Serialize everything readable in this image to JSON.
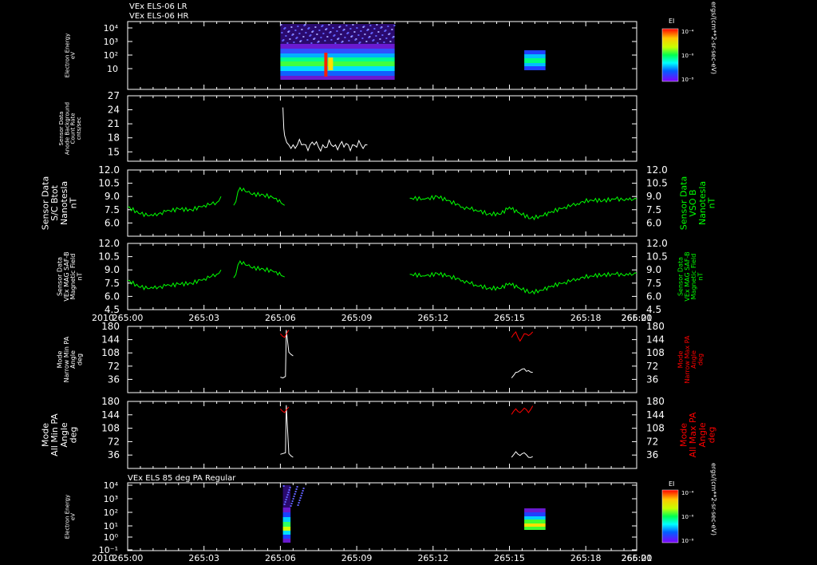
{
  "header": {
    "line1": "VEx ELS-06 LR",
    "line2": "VEx ELS-06 HR",
    "lower_spec_title": "VEx ELS 85 deg PA Regular"
  },
  "time_axis": {
    "year": "2010",
    "ticks": [
      "265:00",
      "265:03",
      "265:06",
      "265:09",
      "265:12",
      "265:15",
      "265:18",
      "265:21",
      "266:00"
    ]
  },
  "colors": {
    "background": "#000000",
    "foreground": "#ffffff",
    "green": "#00ff00",
    "red": "#ff0000"
  },
  "colorbar": {
    "title": "EI",
    "ticks": [
      "10⁻⁴",
      "10⁻⁶",
      "10⁻⁸"
    ],
    "units": "ergs/(cm**2-sr-sec-eV)"
  },
  "chart_data": [
    {
      "type": "heatmap",
      "panel": "spectrogram-lr-hr",
      "ylabel_lines": [
        "Electron Energy",
        "eV"
      ],
      "y_ticks": [
        "10⁴",
        "10³",
        "10²",
        "10"
      ],
      "colorbar": "EI",
      "data_blocks_minutes": [
        [
          0,
          0
        ]
      ]
    },
    {
      "type": "line",
      "panel": "background",
      "ylabel_lines": [
        "Sensor Data",
        "Anode Background",
        "Count Rate",
        "cnts/sec"
      ],
      "y_ticks": [
        "27",
        "24",
        "21",
        "18",
        "15"
      ],
      "ylim": [
        13,
        27
      ],
      "series": [
        {
          "color": "#ffffff",
          "segments": [
            [
              [
                366,
                24.5
              ],
              [
                368,
                20
              ],
              [
                370,
                18.5
              ],
              [
                375,
                17
              ],
              [
                380,
                16.5
              ],
              [
                390,
                16.5
              ],
              [
                400,
                16.5
              ],
              [
                410,
                16.5
              ],
              [
                420,
                16.5
              ],
              [
                430,
                16.5
              ],
              [
                440,
                16.5
              ],
              [
                450,
                16
              ],
              [
                460,
                16.5
              ],
              [
                470,
                16
              ],
              [
                480,
                16.5
              ],
              [
                490,
                16.5
              ],
              [
                500,
                16.5
              ],
              [
                510,
                16
              ],
              [
                520,
                16.5
              ],
              [
                530,
                16.5
              ],
              [
                540,
                16
              ],
              [
                550,
                16.5
              ],
              [
                560,
                16.5
              ],
              [
                565,
                16.5
              ]
            ]
          ]
        }
      ]
    },
    {
      "type": "line",
      "panel": "bfield-total",
      "ylabel_lines": [
        "Sensor Data",
        "S/C Btot",
        "Nanotesla",
        "nT"
      ],
      "ylabel_right_lines": [
        "Sensor Data",
        "VSO B",
        "Nanotesla",
        "nT"
      ],
      "y_ticks": [
        "12.0",
        "10.5",
        "9.0",
        "7.5",
        "6.0"
      ],
      "ylim": [
        4.5,
        12.0
      ],
      "series": [
        {
          "color": "#00ff00",
          "segments": [
            [
              [
                0,
                7.8
              ],
              [
                30,
                7.0
              ],
              [
                60,
                6.8
              ],
              [
                90,
                7.3
              ],
              [
                120,
                7.6
              ],
              [
                150,
                7.5
              ],
              [
                180,
                8.0
              ],
              [
                210,
                8.3
              ],
              [
                220,
                9.0
              ]
            ],
            [
              [
                250,
                8.0
              ],
              [
                265,
                10.0
              ],
              [
                290,
                9.3
              ],
              [
                320,
                9.2
              ],
              [
                350,
                8.8
              ],
              [
                370,
                8.0
              ]
            ],
            [
              [
                665,
                8.8
              ],
              [
                700,
                8.7
              ],
              [
                730,
                9.0
              ],
              [
                760,
                8.5
              ],
              [
                790,
                7.8
              ],
              [
                820,
                7.5
              ],
              [
                850,
                7.0
              ],
              [
                880,
                7.0
              ],
              [
                900,
                7.8
              ],
              [
                920,
                7.2
              ],
              [
                950,
                6.5
              ],
              [
                980,
                6.8
              ],
              [
                1000,
                7.3
              ],
              [
                1030,
                7.8
              ],
              [
                1060,
                8.2
              ],
              [
                1090,
                8.6
              ],
              [
                1120,
                8.5
              ],
              [
                1150,
                8.7
              ],
              [
                1180,
                8.6
              ],
              [
                1200,
                8.7
              ]
            ]
          ]
        }
      ]
    },
    {
      "type": "line",
      "panel": "bfield-mag",
      "ylabel_lines": [
        "Sensor Data",
        "VEx MAG SAF-B",
        "Magnetic Field",
        "nT"
      ],
      "ylabel_right_lines": [
        "Sensor Data",
        "VEx MAG SAF-B",
        "Magnetic Field",
        "nT"
      ],
      "y_ticks": [
        "12.0",
        "10.5",
        "9.0",
        "7.5",
        "6.0",
        "4.5"
      ],
      "ylim": [
        4.5,
        12.0
      ],
      "series": [
        {
          "color": "#00ff00",
          "segments": [
            [
              [
                0,
                7.8
              ],
              [
                30,
                7.0
              ],
              [
                60,
                6.9
              ],
              [
                90,
                7.2
              ],
              [
                120,
                7.4
              ],
              [
                150,
                7.5
              ],
              [
                180,
                8.0
              ],
              [
                210,
                8.5
              ],
              [
                220,
                9.0
              ]
            ],
            [
              [
                250,
                8.1
              ],
              [
                265,
                10.0
              ],
              [
                290,
                9.3
              ],
              [
                320,
                9.1
              ],
              [
                350,
                8.8
              ],
              [
                370,
                8.2
              ]
            ],
            [
              [
                665,
                8.5
              ],
              [
                700,
                8.3
              ],
              [
                730,
                8.6
              ],
              [
                760,
                8.3
              ],
              [
                790,
                7.8
              ],
              [
                820,
                7.3
              ],
              [
                850,
                6.9
              ],
              [
                880,
                6.9
              ],
              [
                900,
                7.5
              ],
              [
                920,
                7.0
              ],
              [
                950,
                6.4
              ],
              [
                980,
                6.7
              ],
              [
                1000,
                7.2
              ],
              [
                1030,
                7.6
              ],
              [
                1060,
                8.0
              ],
              [
                1090,
                8.3
              ],
              [
                1120,
                8.4
              ],
              [
                1150,
                8.5
              ],
              [
                1180,
                8.4
              ],
              [
                1200,
                8.6
              ]
            ]
          ]
        }
      ]
    },
    {
      "type": "line",
      "panel": "narrow-pa",
      "ylabel_lines": [
        "Mode",
        "Narrow Min PA",
        "Angle",
        "deg"
      ],
      "ylabel_right_lines": [
        "Mode",
        "Narrow Max PA",
        "Angle",
        "deg"
      ],
      "y_ticks": [
        "180",
        "144",
        "108",
        "72",
        "36"
      ],
      "ylim": [
        0,
        180
      ],
      "series": [
        {
          "color": "#ffffff",
          "segments": [
            [
              [
                360,
                42
              ],
              [
                366,
                40
              ],
              [
                372,
                44
              ],
              [
                374,
                170
              ],
              [
                380,
                110
              ],
              [
                390,
                100
              ]
            ],
            [
              [
                905,
                40
              ],
              [
                915,
                55
              ],
              [
                925,
                60
              ],
              [
                935,
                65
              ],
              [
                940,
                58
              ],
              [
                945,
                60
              ],
              [
                955,
                55
              ]
            ]
          ]
        },
        {
          "color": "#ff0000",
          "segments": [
            [
              [
                360,
                160
              ],
              [
                370,
                150
              ],
              [
                380,
                170
              ]
            ],
            [
              [
                905,
                150
              ],
              [
                915,
                165
              ],
              [
                925,
                140
              ],
              [
                935,
                160
              ],
              [
                945,
                155
              ],
              [
                955,
                165
              ]
            ]
          ]
        }
      ]
    },
    {
      "type": "line",
      "panel": "all-pa",
      "ylabel_lines": [
        "Mode",
        "All Min PA",
        "Angle",
        "deg"
      ],
      "ylabel_right_lines": [
        "Mode",
        "All Max PA",
        "Angle",
        "deg"
      ],
      "y_ticks": [
        "180",
        "144",
        "108",
        "72",
        "36"
      ],
      "ylim": [
        0,
        180
      ],
      "series": [
        {
          "color": "#ffffff",
          "segments": [
            [
              [
                360,
                38
              ],
              [
                366,
                40
              ],
              [
                372,
                42
              ],
              [
                374,
                170
              ],
              [
                380,
                40
              ],
              [
                390,
                30
              ]
            ],
            [
              [
                905,
                30
              ],
              [
                915,
                45
              ],
              [
                925,
                35
              ],
              [
                935,
                42
              ],
              [
                945,
                30
              ],
              [
                955,
                32
              ]
            ]
          ]
        },
        {
          "color": "#ff0000",
          "segments": [
            [
              [
                360,
                160
              ],
              [
                370,
                150
              ],
              [
                380,
                165
              ]
            ],
            [
              [
                905,
                145
              ],
              [
                915,
                160
              ],
              [
                925,
                150
              ],
              [
                935,
                162
              ],
              [
                945,
                150
              ],
              [
                955,
                168
              ]
            ]
          ]
        }
      ]
    },
    {
      "type": "heatmap",
      "panel": "spectrogram-85pa",
      "ylabel_lines": [
        "Electron Energy",
        "eV"
      ],
      "y_ticks": [
        "10⁴",
        "10³",
        "10²",
        "10¹",
        "10⁰",
        "10⁻¹"
      ],
      "colorbar": "EI"
    }
  ]
}
